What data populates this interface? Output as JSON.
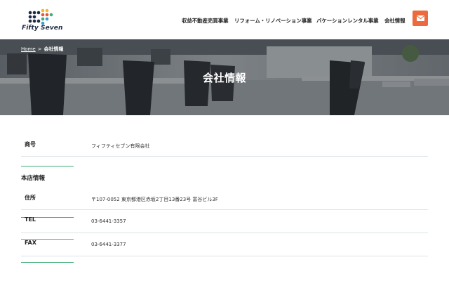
{
  "header": {
    "logo_text": "Fifty Seven",
    "nav": [
      {
        "label": "収益不動産売買事業"
      },
      {
        "label": "リフォーム・リノベーション事業"
      },
      {
        "label": "バケーションレンタル事業"
      },
      {
        "label": "会社情報"
      }
    ],
    "mail_icon": "envelope-icon",
    "accent_color": "#ec6a3d"
  },
  "hero": {
    "breadcrumb": {
      "home": "Home",
      "separator": ">",
      "current": "会社情報"
    },
    "title": "会社情報"
  },
  "company": {
    "trade_name": {
      "label": "商号",
      "value": "フィフティセブン有限会社"
    }
  },
  "head_office": {
    "heading": "本店情報",
    "rows": [
      {
        "label": "住所",
        "value": "〒107-0052  東京都港区赤坂2丁目13番23号  富谷ビル3F"
      },
      {
        "label": "TEL",
        "value": "03-6441-3357"
      },
      {
        "label": "FAX",
        "value": "03-6441-3377"
      }
    ]
  },
  "colors": {
    "label_underline": "#3fae78",
    "row_border": "#dde2e6"
  }
}
